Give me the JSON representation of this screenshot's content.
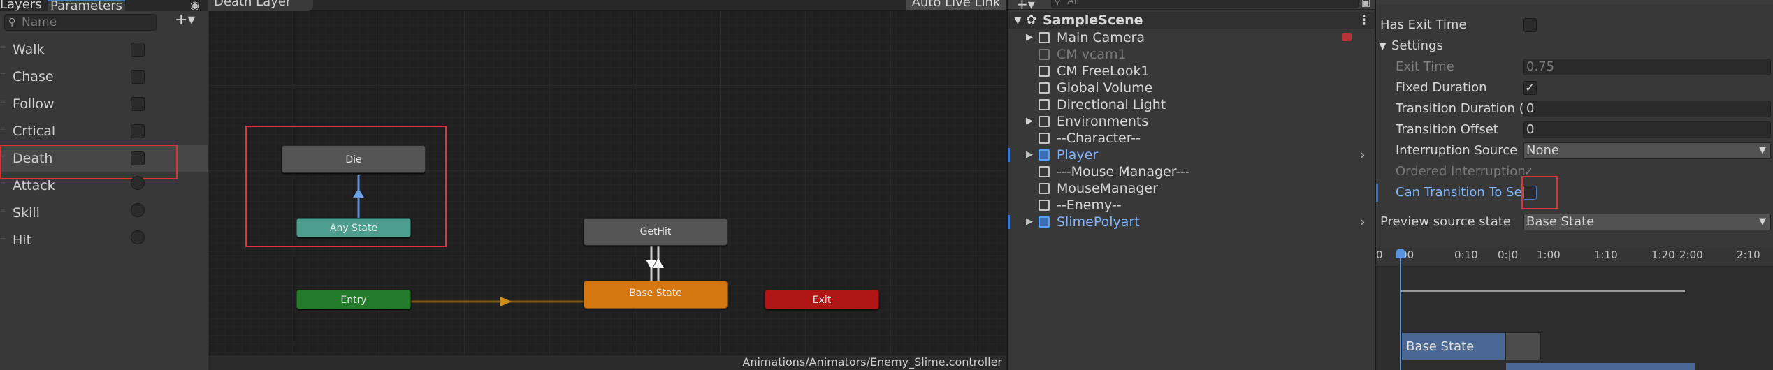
{
  "params_panel": {
    "tabs": [
      "Layers",
      "Parameters"
    ],
    "search_placeholder": "Name",
    "add_label": "+▾",
    "items": [
      {
        "name": "Walk",
        "kind": "bool"
      },
      {
        "name": "Chase",
        "kind": "bool"
      },
      {
        "name": "Follow",
        "kind": "bool"
      },
      {
        "name": "Crtical",
        "kind": "bool"
      },
      {
        "name": "Death",
        "kind": "bool"
      },
      {
        "name": "Attack",
        "kind": "trigger"
      },
      {
        "name": "Skill",
        "kind": "trigger"
      },
      {
        "name": "Hit",
        "kind": "trigger"
      }
    ]
  },
  "graph": {
    "layer_title": "Death Layer",
    "auto_live_link": "Auto Live Link",
    "path": "Animations/Animators/Enemy_Slime.controller",
    "nodes": {
      "die": "Die",
      "any_state": "Any State",
      "get_hit": "GetHit",
      "entry": "Entry",
      "base_state": "Base State",
      "exit": "Exit"
    }
  },
  "hierarchy": {
    "search_placeholder": "All",
    "add_label": "+▾",
    "scene": "SampleScene",
    "items": [
      {
        "label": "Main Camera",
        "expandable": true,
        "dim": false,
        "prefab": false
      },
      {
        "label": "CM vcam1",
        "expandable": false,
        "dim": true,
        "prefab": false
      },
      {
        "label": "CM FreeLook1",
        "expandable": false,
        "dim": false,
        "prefab": false
      },
      {
        "label": "Global Volume",
        "expandable": false,
        "dim": false,
        "prefab": false
      },
      {
        "label": "Directional Light",
        "expandable": false,
        "dim": false,
        "prefab": false
      },
      {
        "label": "Environments",
        "expandable": true,
        "dim": false,
        "prefab": false
      },
      {
        "label": "--Character--",
        "expandable": false,
        "dim": false,
        "prefab": false
      },
      {
        "label": "Player",
        "expandable": true,
        "dim": false,
        "prefab": true
      },
      {
        "label": "---Mouse Manager---",
        "expandable": false,
        "dim": false,
        "prefab": false
      },
      {
        "label": "MouseManager",
        "expandable": false,
        "dim": false,
        "prefab": false
      },
      {
        "label": "--Enemy--",
        "expandable": false,
        "dim": false,
        "prefab": false
      },
      {
        "label": "SlimePolyart",
        "expandable": true,
        "dim": false,
        "prefab": true
      }
    ]
  },
  "inspector": {
    "has_exit_time": "Has Exit Time",
    "settings": "Settings",
    "exit_time_label": "Exit Time",
    "exit_time_value": "0.75",
    "fixed_duration": "Fixed Duration",
    "transition_duration_label": "Transition Duration (",
    "transition_duration_value": "0",
    "transition_offset_label": "Transition Offset",
    "transition_offset_value": "0",
    "interruption_source_label": "Interruption Source",
    "interruption_source_value": "None",
    "ordered_interruption": "Ordered Interruption",
    "can_transition": "Can Transition To Se",
    "preview_label": "Preview source state",
    "preview_value": "Base State",
    "timeline_ticks": [
      ":00",
      "0:10",
      "0:|0",
      "1:00",
      "1:10",
      "1:20",
      "2:00",
      "2:10"
    ],
    "timeline_start": "0",
    "timeline_state": "Base State"
  }
}
